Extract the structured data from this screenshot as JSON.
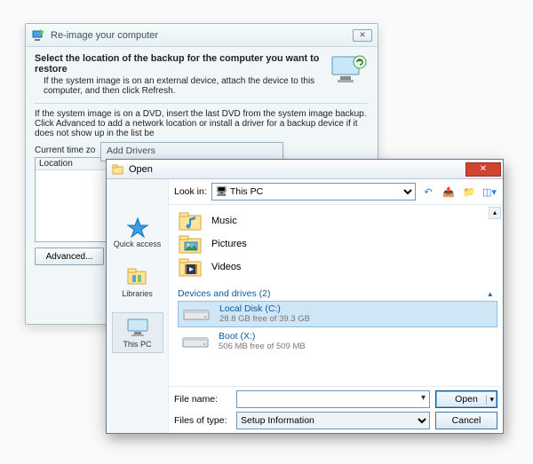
{
  "reimage": {
    "title": "Re-image your computer",
    "heading": "Select the location of the backup for the computer you want to restore",
    "sub": "If the system image is on an external device, attach the device to this computer, and then click Refresh.",
    "note": "If the system image is on a DVD, insert the last DVD from the system image backup. Click Advanced to add a network location or install a driver for a backup device if it does not show up in the list be",
    "czone_label": "Current time zo",
    "list_header": "Location",
    "advanced_btn": "Advanced..."
  },
  "overlay_title": "Add Drivers",
  "open": {
    "title": "Open",
    "lookin_label": "Look in:",
    "lookin_value": "This PC",
    "toolbar": {
      "back": "back-icon",
      "up": "up-icon",
      "newfolder": "new-folder-icon",
      "views": "views-icon"
    },
    "places": [
      {
        "id": "quick",
        "label": "Quick access"
      },
      {
        "id": "libraries",
        "label": "Libraries"
      },
      {
        "id": "thispc",
        "label": "This PC",
        "selected": true
      }
    ],
    "folders": [
      {
        "id": "music",
        "label": "Music"
      },
      {
        "id": "pictures",
        "label": "Pictures"
      },
      {
        "id": "videos",
        "label": "Videos"
      }
    ],
    "section_label": "Devices and drives (2)",
    "drives": [
      {
        "id": "c",
        "name": "Local Disk (C:)",
        "free": "28.8 GB free of 39.3 GB",
        "selected": true
      },
      {
        "id": "x",
        "name": "Boot (X:)",
        "free": "506 MB free of 509 MB",
        "selected": false
      }
    ],
    "filename_label": "File name:",
    "filename_value": "",
    "filetype_label": "Files of type:",
    "filetype_value": "Setup Information",
    "open_btn": "Open",
    "cancel_btn": "Cancel"
  }
}
